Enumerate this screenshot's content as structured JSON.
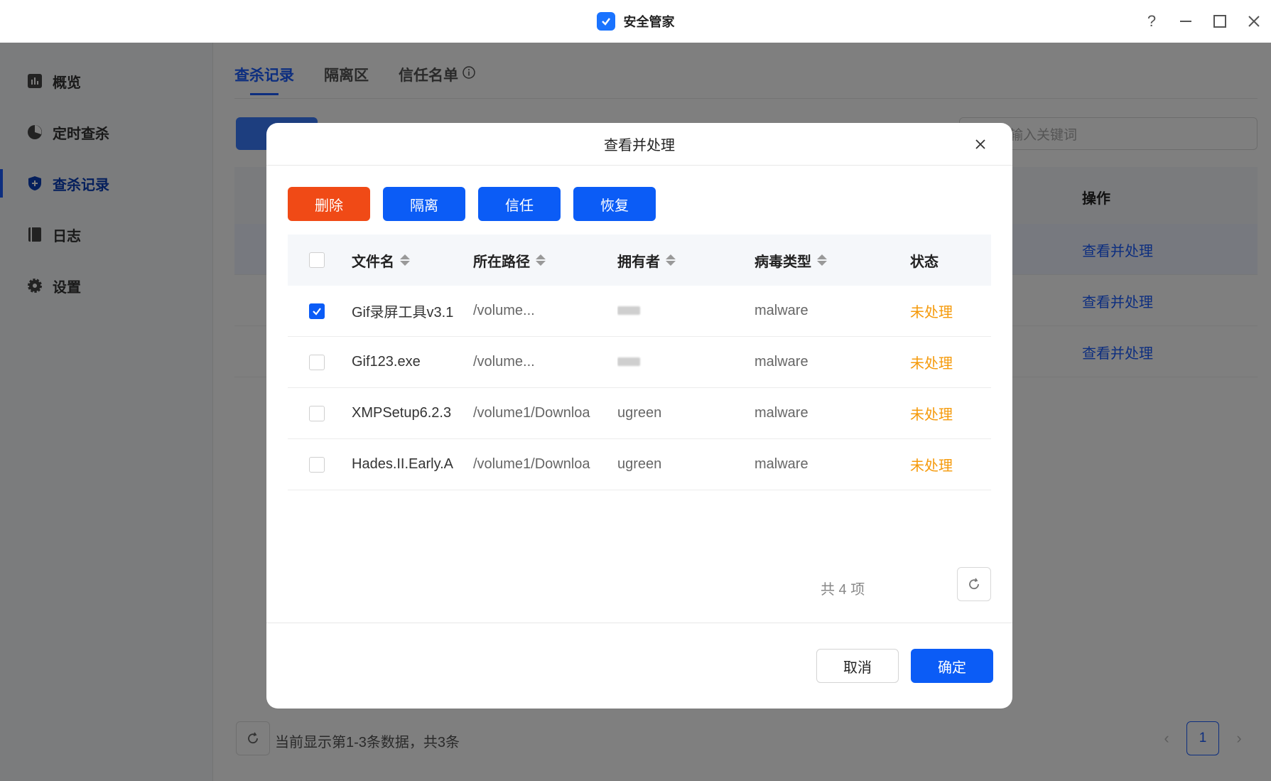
{
  "window": {
    "title": "安全管家",
    "icons": {
      "app": "shield-check-icon",
      "help": "help-icon",
      "minimize": "minimize-icon",
      "maximize": "maximize-icon",
      "close": "close-icon"
    }
  },
  "sidebar": {
    "items": [
      {
        "label": "概览",
        "icon": "chart-icon",
        "active": false
      },
      {
        "label": "定时查杀",
        "icon": "clock-icon",
        "active": false
      },
      {
        "label": "查杀记录",
        "icon": "shield-plus-icon",
        "active": true
      },
      {
        "label": "日志",
        "icon": "book-icon",
        "active": false
      },
      {
        "label": "设置",
        "icon": "gear-icon",
        "active": false
      }
    ]
  },
  "tabs": [
    {
      "label": "查杀记录",
      "active": true
    },
    {
      "label": "隔离区",
      "active": false
    },
    {
      "label": "信任名单",
      "active": false,
      "icon": "info-icon"
    }
  ],
  "background": {
    "search_placeholder": "输入关键词",
    "op_header": "操作",
    "row_links": [
      "查看并处理",
      "查看并处理",
      "查看并处理"
    ],
    "footer_text": "当前显示第1-3条数据，共3条",
    "current_page": "1"
  },
  "dialog": {
    "title": "查看并处理",
    "actions": {
      "delete": "删除",
      "isolate": "隔离",
      "trust": "信任",
      "restore": "恢复"
    },
    "columns": {
      "name": "文件名",
      "path": "所在路径",
      "owner": "拥有者",
      "type": "病毒类型",
      "status": "状态"
    },
    "rows": [
      {
        "checked": true,
        "name": "Gif录屏工具v3.1",
        "path": "/volume...",
        "owner": "",
        "type": "malware",
        "status": "未处理"
      },
      {
        "checked": false,
        "name": "Gif123.exe",
        "path": "/volume...",
        "owner": "",
        "type": "malware",
        "status": "未处理"
      },
      {
        "checked": false,
        "name": "XMPSetup6.2.3",
        "path": "/volume1/Downloa",
        "owner": "ugreen",
        "type": "malware",
        "status": "未处理"
      },
      {
        "checked": false,
        "name": "Hades.II.Early.A",
        "path": "/volume1/Downloa",
        "owner": "ugreen",
        "type": "malware",
        "status": "未处理"
      }
    ],
    "count_text": "共 4 项",
    "cancel": "取消",
    "confirm": "确定"
  }
}
